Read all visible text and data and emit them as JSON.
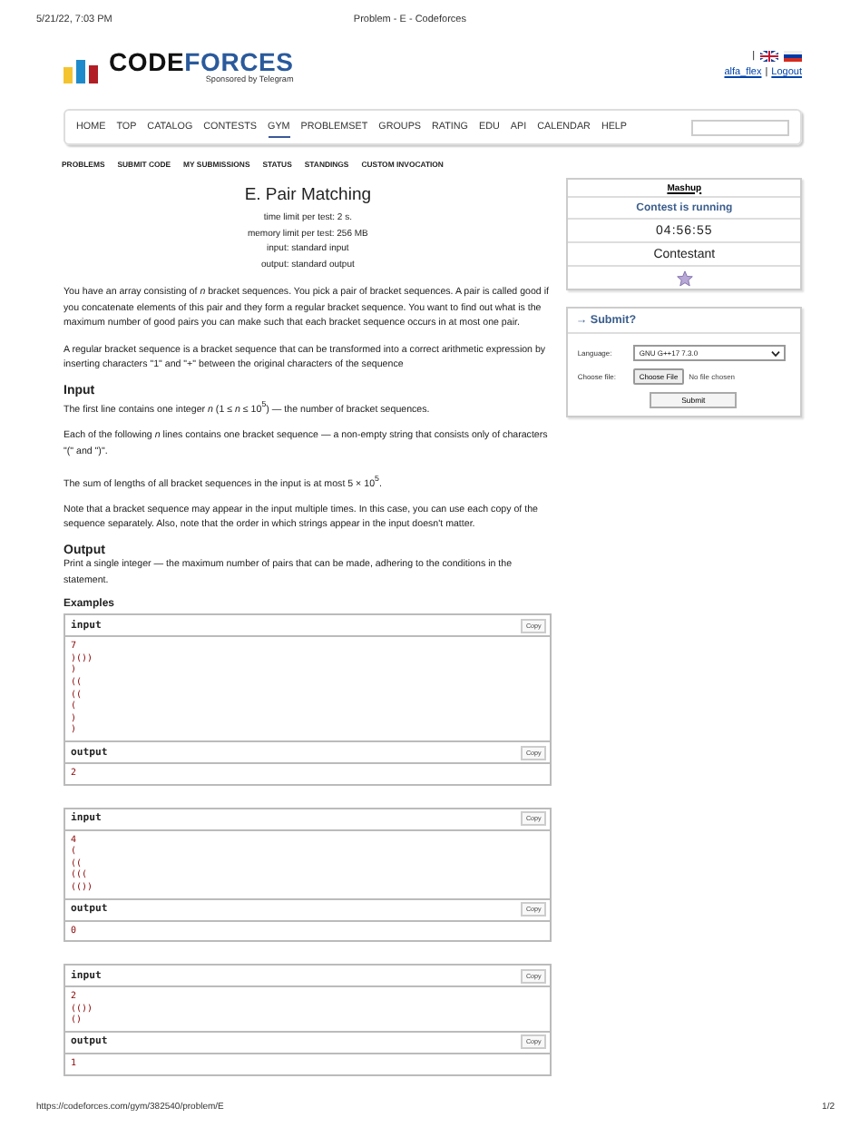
{
  "print_header": {
    "date": "5/21/22, 7:03 PM",
    "title": "Problem - E - Codeforces"
  },
  "logo": {
    "part_a": "CODE",
    "part_b": "FORCES",
    "tagline": "Sponsored by Telegram"
  },
  "user": {
    "separator_top": "|",
    "username": "alfa_flex",
    "separator": "|",
    "logout": "Logout"
  },
  "nav": [
    {
      "label": "HOME",
      "selected": false
    },
    {
      "label": "TOP",
      "selected": false
    },
    {
      "label": "CATALOG",
      "selected": false
    },
    {
      "label": "CONTESTS",
      "selected": false
    },
    {
      "label": "GYM",
      "selected": true
    },
    {
      "label": "PROBLEMSET",
      "selected": false
    },
    {
      "label": "GROUPS",
      "selected": false
    },
    {
      "label": "RATING",
      "selected": false
    },
    {
      "label": "EDU",
      "selected": false
    },
    {
      "label": "API",
      "selected": false
    },
    {
      "label": "CALENDAR",
      "selected": false
    },
    {
      "label": "HELP",
      "selected": false
    }
  ],
  "subnav": [
    "PROBLEMS",
    "SUBMIT CODE",
    "MY SUBMISSIONS",
    "STATUS",
    "STANDINGS",
    "CUSTOM INVOCATION"
  ],
  "problem": {
    "title": "E. Pair Matching",
    "limits": [
      "time limit per test: 2 s.",
      "memory limit per test: 256 MB",
      "input: standard input",
      "output: standard output"
    ],
    "legend": [
      "You have an array consisting of *n* bracket sequences. You pick a pair of bracket sequences. A pair is called good if you concatenate elements of this pair and they form a regular bracket sequence. You want to find out what is the maximum number of good pairs you can make such that each bracket sequence occurs in at most one pair.",
      "A regular bracket sequence is a bracket sequence that can be transformed into a correct arithmetic expression by inserting characters \"1\" and \"+\" between the original characters of the sequence"
    ],
    "sections": [
      {
        "title": "Input",
        "paragraphs": [
          "The first line contains one integer *n* (1 ≤ *n* ≤ 10$^{5}$) — the number of bracket sequences.",
          "Each of the following *n* lines contains one bracket sequence — a non-empty string that consists only of characters \"(\" and \")\".",
          "The sum of lengths of all bracket sequences in the input is at most 5 × 10$^{5}$.",
          "Note that a bracket sequence may appear in the input multiple times. In this case, you can use each copy of the sequence separately. Also, note that the order in which strings appear in the input doesn't matter."
        ]
      },
      {
        "title": "Output",
        "paragraphs": [
          "Print a single integer — the maximum number of pairs that can be made, adhering to the conditions in the statement."
        ]
      }
    ]
  },
  "examples": {
    "title": "Examples",
    "tests": [
      {
        "input_label": "input",
        "input_copy": "Copy",
        "input_lines": [
          "7",
          ")())",
          ")",
          "((",
          "((",
          "(",
          ")",
          ")"
        ],
        "output_label": "output",
        "output_copy": "Copy",
        "output_lines": [
          "2"
        ]
      },
      {
        "input_label": "input",
        "input_copy": "Copy",
        "input_lines": [
          "4",
          "(",
          "((",
          "(((",
          "(())"
        ],
        "output_label": "output",
        "output_copy": "Copy",
        "output_lines": [
          "0"
        ]
      },
      {
        "input_label": "input",
        "input_copy": "Copy",
        "input_lines": [
          "2",
          "(())",
          "()"
        ],
        "output_label": "output",
        "output_copy": "Copy",
        "output_lines": [
          "1"
        ]
      }
    ]
  },
  "sidebar": {
    "contest": {
      "name": "Mashup",
      "status": "Contest is running",
      "timer": "04:56:55",
      "role": "Contestant"
    },
    "submit": {
      "title": "→ Submit?",
      "language_label": "Language:",
      "language": "GNU G++17 7.3.0",
      "file_label": "Choose file:",
      "file_button": "Choose File",
      "file_status": "No file chosen",
      "button": "Submit"
    }
  },
  "print_footer": {
    "url": "https://codeforces.com/gym/382540/problem/E",
    "page": "1/2"
  }
}
